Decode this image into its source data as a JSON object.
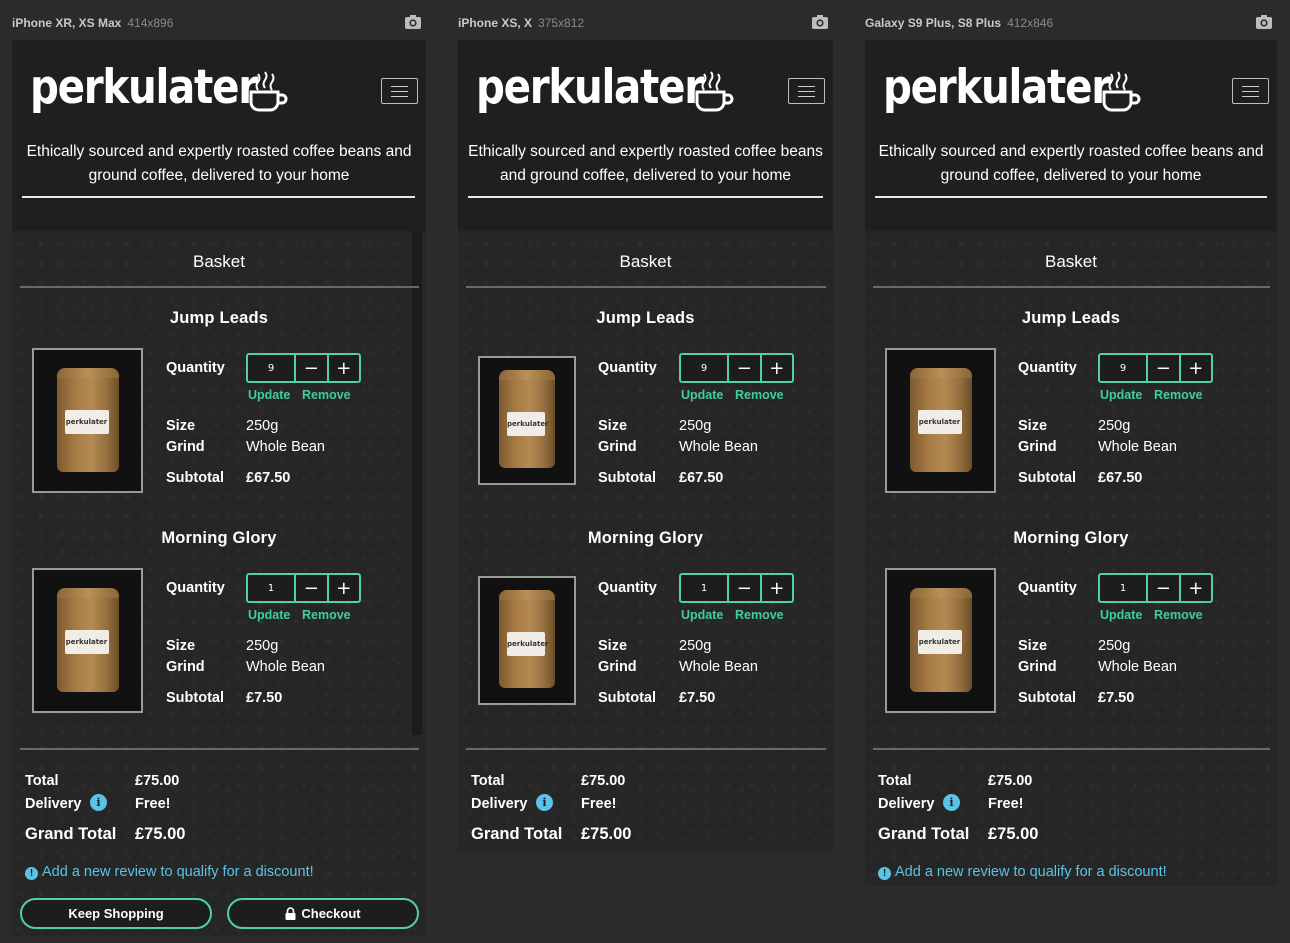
{
  "devices": [
    {
      "name": "iPhone XR, XS Max",
      "dims": "414x896"
    },
    {
      "name": "iPhone XS, X",
      "dims": "375x812"
    },
    {
      "name": "Galaxy S9 Plus, S8 Plus",
      "dims": "412x846"
    }
  ],
  "brand": {
    "logo": "perkulater",
    "tagline_line1": "Ethically sourced and expertly roasted coffee beans and",
    "tagline_line2": "ground coffee, delivered to your home",
    "tagline_alt_line1": "Ethically sourced and expertly roasted coffee beans",
    "tagline_alt_line2": "and ground coffee, delivered to your home",
    "bag_label": "perkulater"
  },
  "basket": {
    "title": "Basket",
    "labels": {
      "quantity": "Quantity",
      "size": "Size",
      "grind": "Grind",
      "subtotal": "Subtotal",
      "update": "Update",
      "remove": "Remove",
      "minus": "−",
      "plus": "+"
    },
    "items": [
      {
        "name": "Jump Leads",
        "qty": "9",
        "size": "250g",
        "grind": "Whole Bean",
        "subtotal": "£67.50"
      },
      {
        "name": "Morning Glory",
        "qty": "1",
        "size": "250g",
        "grind": "Whole Bean",
        "subtotal": "£7.50"
      }
    ]
  },
  "totals": {
    "total_label": "Total",
    "total": "£75.00",
    "delivery_label": "Delivery",
    "delivery": "Free!",
    "grand_label": "Grand Total",
    "grand": "£75.00"
  },
  "review_prompt": "Add a new review to qualify for a discount!",
  "buttons": {
    "keep_shopping": "Keep Shopping",
    "checkout": "Checkout"
  },
  "colors": {
    "accent": "#4fd1a5",
    "info": "#5bc3e6",
    "background": "#2b2b2b"
  }
}
